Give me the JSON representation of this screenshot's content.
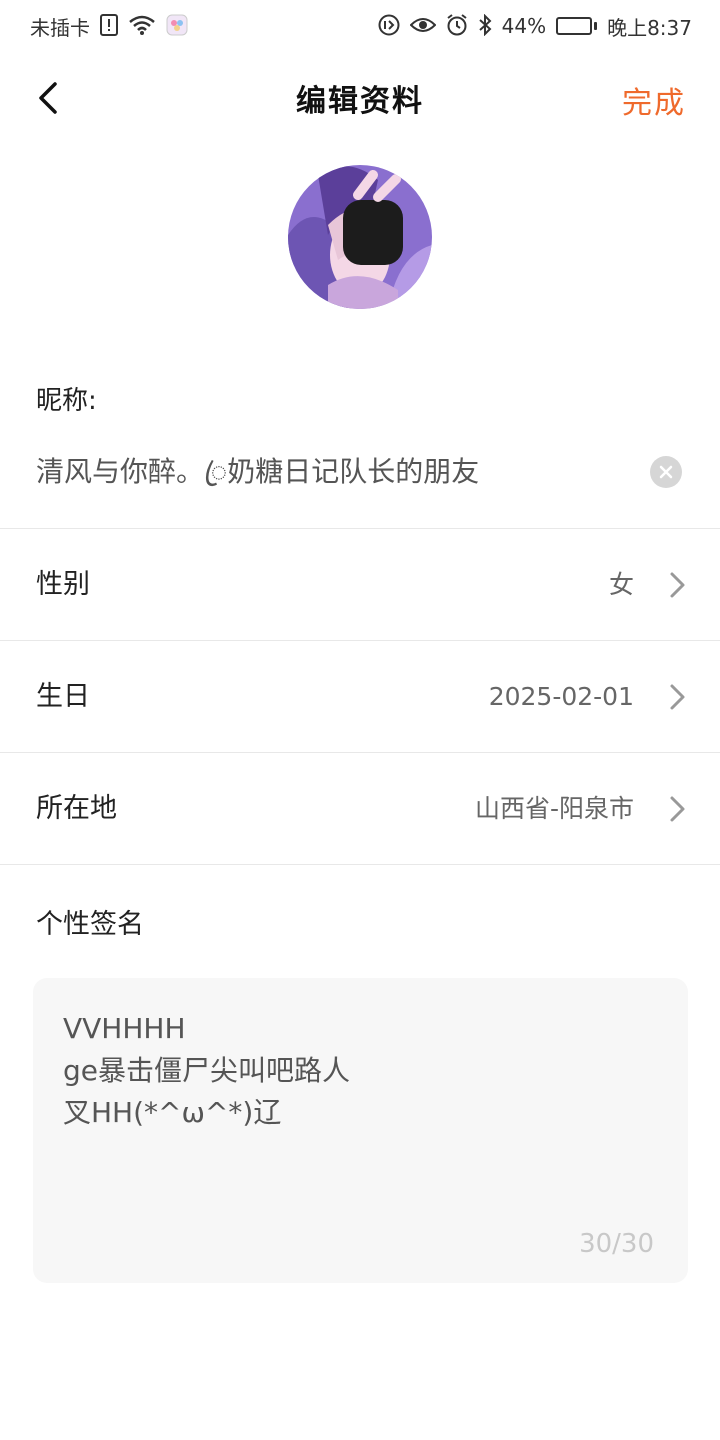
{
  "status_bar": {
    "carrier": "未插卡",
    "battery": "44%",
    "time": "晚上8:37",
    "battery_level": 0.44
  },
  "nav": {
    "title": "编辑资料",
    "done_label": "完成",
    "accent_color": "#ef6a2c"
  },
  "profile": {
    "nickname_label": "昵称:",
    "nickname_value": "清风与你醉。ꦿ奶糖日记队长的朋友",
    "fields": [
      {
        "label": "性别",
        "value": "女"
      },
      {
        "label": "生日",
        "value": "2025-02-01"
      },
      {
        "label": "所在地",
        "value": "山西省-阳泉市"
      }
    ],
    "signature_label": "个性签名",
    "signature_value": "VVHHHH\nge暴击僵尸尖叫吧路人\n叉HH(*^ω^*)辽",
    "signature_count": "30/30"
  }
}
